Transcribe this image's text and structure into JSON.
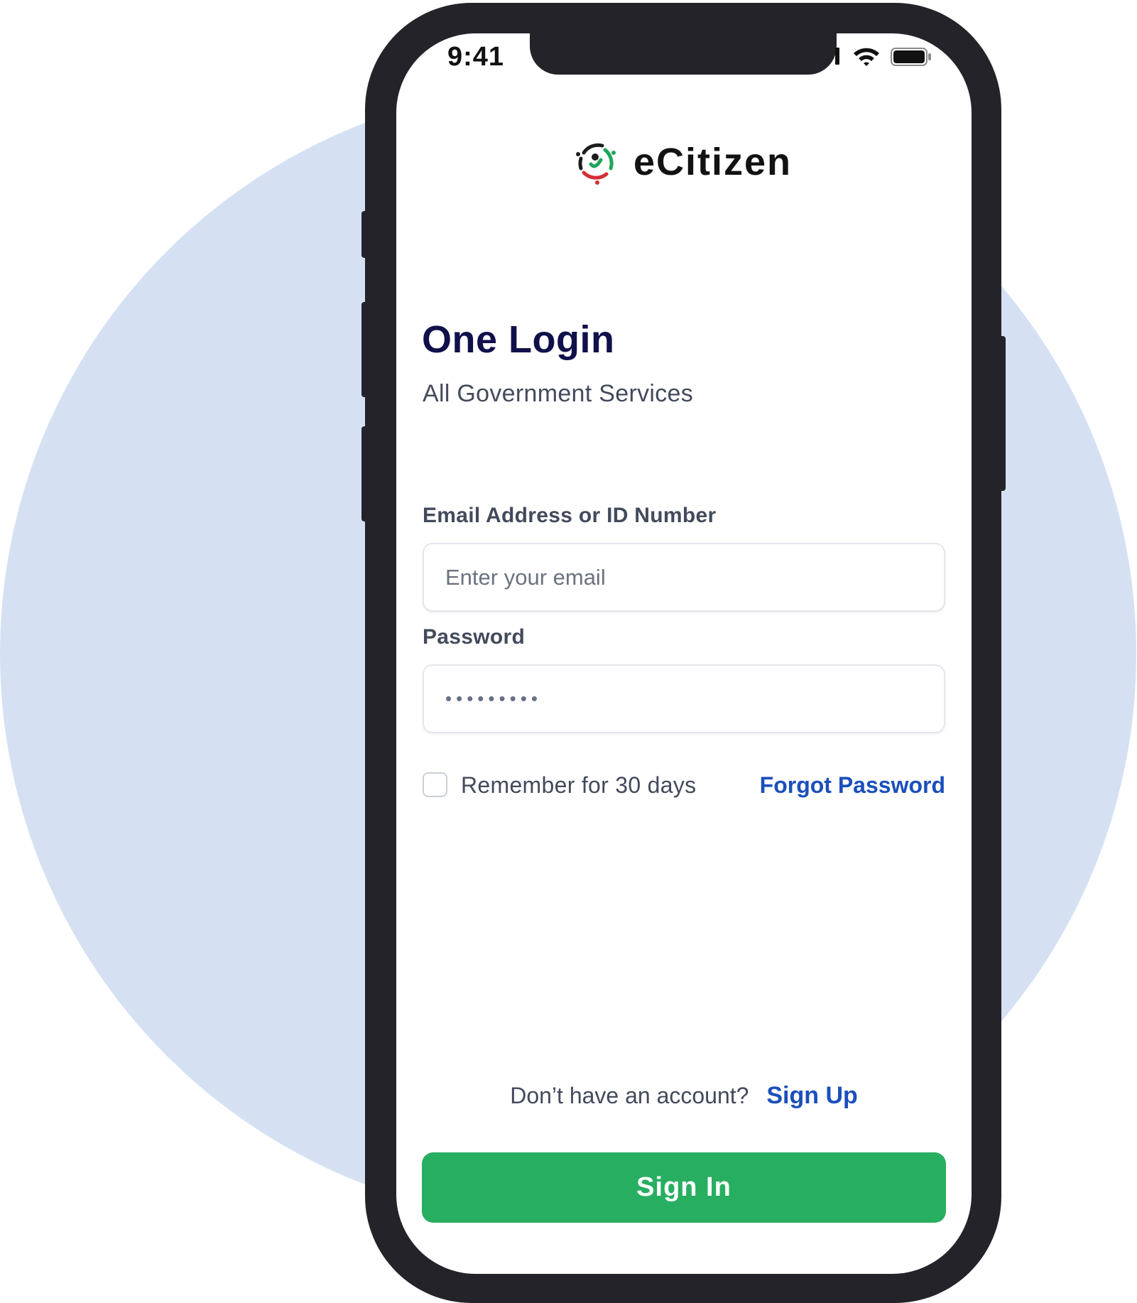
{
  "status_bar": {
    "time": "9:41",
    "icons": [
      "cellular-icon",
      "wifi-icon",
      "battery-icon"
    ]
  },
  "brand": {
    "name": "eCitizen",
    "logo_icon": "ecitizen-logo-icon",
    "logo_colors": [
      "#1fa55a",
      "#d62c35",
      "#1d1d1d"
    ]
  },
  "header": {
    "title": "One Login",
    "subtitle": "All Government Services"
  },
  "form": {
    "email_label": "Email Address or ID Number",
    "email_placeholder": "Enter your email",
    "email_value": "",
    "password_label": "Password",
    "password_value": "•••••••••",
    "remember_label": "Remember for 30 days",
    "remember_checked": false,
    "forgot_link": "Forgot Password"
  },
  "footer": {
    "signup_prompt": "Don’t have an account?",
    "signup_link": "Sign Up",
    "signin_button": "Sign In"
  },
  "colors": {
    "background_circle": "#d5e1f3",
    "phone_frame": "#25232a",
    "title": "#10104a",
    "link": "#1a4fbc",
    "primary_button": "#28ae60"
  }
}
